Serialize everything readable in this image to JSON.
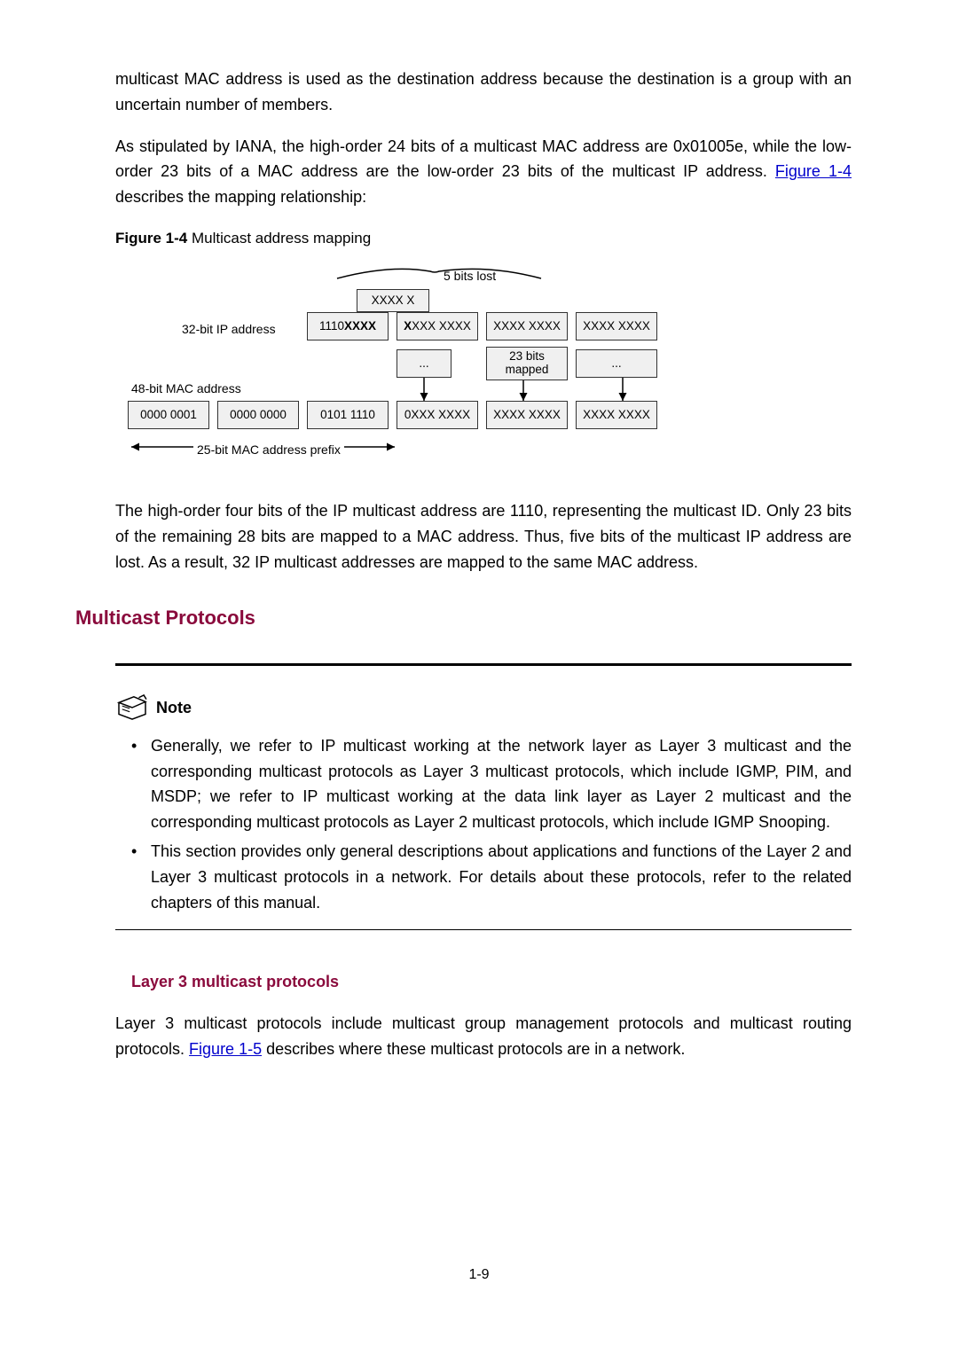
{
  "paragraphs": {
    "p1": "multicast MAC address is used as the destination address because the destination is a group with an uncertain number of members.",
    "p2a": "As stipulated by IANA, the high-order 24 bits of a multicast MAC address are 0x01005e, while the low-order 23 bits of a MAC address are the low-order 23 bits of the multicast IP address. ",
    "p2b": " describes the mapping relationship:",
    "p3": "The high-order four bits of the IP multicast address are 1110, representing the multicast ID. Only 23 bits of the remaining 28 bits are mapped to a MAC address. Thus, five bits of the multicast IP address are lost. As a result, 32 IP multicast addresses are mapped to the same MAC address.",
    "p4a": "Layer 3 multicast protocols include multicast group management protocols and multicast routing protocols. ",
    "p4b": " describes where these multicast protocols are in a network."
  },
  "links": {
    "fig14": "Figure 1-4",
    "fig15": "Figure 1-5"
  },
  "figure_caption": {
    "label": "Figure 1-4",
    "text": " Multicast address mapping"
  },
  "diagram": {
    "five_bits_lost": "5 bits lost",
    "xxxx_x": "XXXX X",
    "ip_addr_label": "32-bit IP address",
    "ip_row": [
      "1110 ",
      "XXXX",
      "X",
      "XXX XXXX",
      "XXXX XXXX",
      "XXXX XXXX"
    ],
    "dots": "...",
    "bits23_a": "23 bits",
    "bits23_b": "mapped",
    "mac_addr_label": "48-bit MAC address",
    "mac_row": [
      "0000 0001",
      "0000 0000",
      "0101 1110",
      "0XXX XXXX",
      "XXXX XXXX",
      "XXXX XXXX"
    ],
    "prefix_label": "25-bit MAC address prefix"
  },
  "headings": {
    "h2": "Multicast Protocols",
    "h3": "Layer 3 multicast protocols"
  },
  "note": {
    "title": "Note",
    "li1": "Generally, we refer to IP multicast working at the network layer as Layer 3 multicast and the corresponding multicast protocols as Layer 3 multicast protocols, which include IGMP, PIM, and MSDP; we refer to IP multicast working at the data link layer as Layer 2 multicast and the corresponding multicast protocols as Layer 2 multicast protocols, which include IGMP Snooping.",
    "li2": "This section provides only general descriptions about applications and functions of the Layer 2 and Layer 3 multicast protocols in a network. For details about these protocols, refer to the related chapters of this manual."
  },
  "page_number": "1-9"
}
